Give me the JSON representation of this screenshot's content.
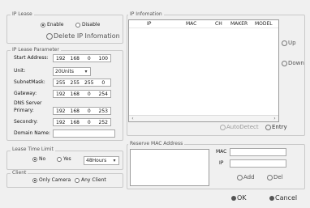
{
  "ip_lease": {
    "legend": "IP Lease",
    "enable_label": "Enable",
    "disable_label": "Disable",
    "delete_label": "Delete IP Infomation"
  },
  "param": {
    "legend": "IP Lease Parameter",
    "start_label": "Start Address:",
    "start": [
      "192",
      "168",
      "0",
      "100"
    ],
    "unit_label": "Unit:",
    "unit_value": "20Units",
    "mask_label": "SubnetMask:",
    "mask": [
      "255",
      "255",
      "255",
      "0"
    ],
    "gateway_label": "Gateway:",
    "gateway": [
      "192",
      "168",
      "0",
      "254"
    ],
    "dns_label": "DNS Server",
    "primary_label": "Primary:",
    "primary": [
      "192",
      "168",
      "0",
      "253"
    ],
    "secondary_label": "Secondry:",
    "secondary": [
      "192",
      "168",
      "0",
      "252"
    ],
    "domain_label": "Domain Name:"
  },
  "lease_time": {
    "legend": "Lease Time Limit",
    "no_label": "No",
    "yes_label": "Yes",
    "value": "48Hours"
  },
  "client": {
    "legend": "Client",
    "only_camera_label": "Only Camera",
    "any_client_label": "Any Client"
  },
  "ip_info": {
    "legend": "IP Infomation",
    "columns": [
      "IP",
      "MAC",
      "CH",
      "MAKER",
      "MODEL"
    ],
    "up_label": "Up",
    "down_label": "Down",
    "autodetect_label": "AutoDetect",
    "entry_label": "Entry"
  },
  "reserve": {
    "legend": "Reserve MAC Address",
    "mac_label": "MAC",
    "ip_label": "IP",
    "add_label": "Add",
    "del_label": "Del"
  },
  "footer": {
    "ok_label": "OK",
    "cancel_label": "Cancel"
  }
}
